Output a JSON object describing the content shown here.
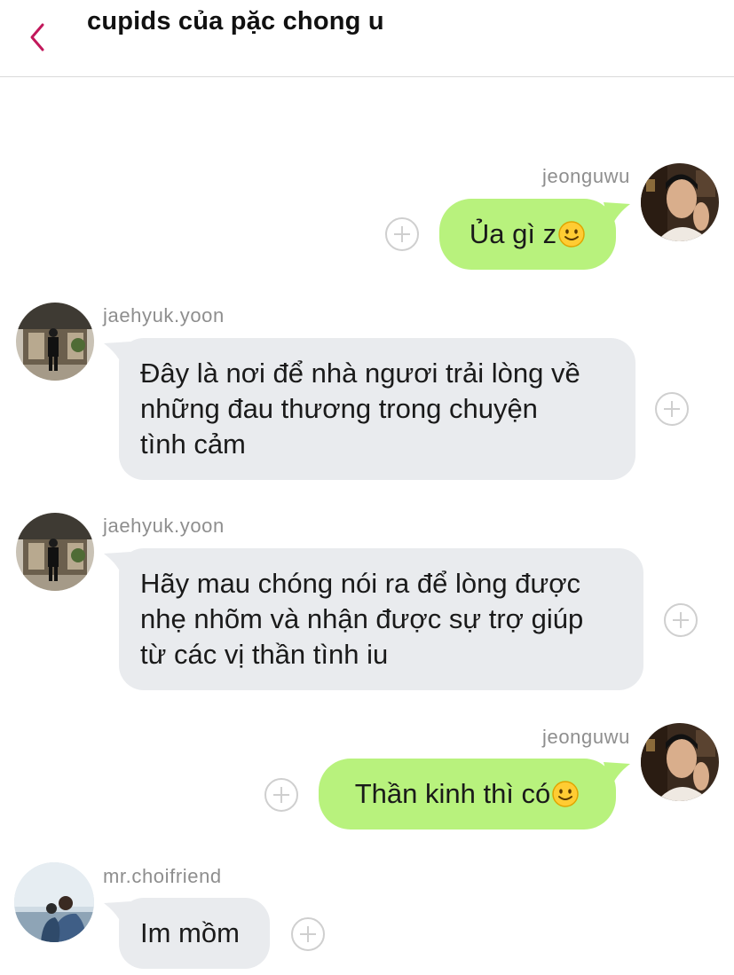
{
  "header": {
    "title": "cupids của pặc chong u"
  },
  "colors": {
    "outgoing_bubble": "#b8f27d",
    "incoming_bubble": "#e9ebee",
    "back_accent": "#c2185b"
  },
  "messages": [
    {
      "direction": "outgoing",
      "sender": "jeonguwu",
      "text": "Ủa gì z",
      "emoji": "slightly-smiling-face"
    },
    {
      "direction": "incoming",
      "sender": "jaehyuk.yoon",
      "lines": [
        "Đây là nơi để nhà ngươi trải lòng về",
        "những đau thương trong chuyện",
        "tình cảm"
      ]
    },
    {
      "direction": "incoming",
      "sender": "jaehyuk.yoon",
      "lines": [
        "Hãy mau chóng nói ra để lòng được",
        "nhẹ nhõm và nhận được sự trợ giúp",
        "từ các vị thần tình iu"
      ]
    },
    {
      "direction": "outgoing",
      "sender": "jeonguwu",
      "text": "Thần kinh thì có",
      "emoji": "slightly-smiling-face"
    },
    {
      "direction": "incoming",
      "sender": "mr.choifriend",
      "text": "Im mồm"
    }
  ]
}
